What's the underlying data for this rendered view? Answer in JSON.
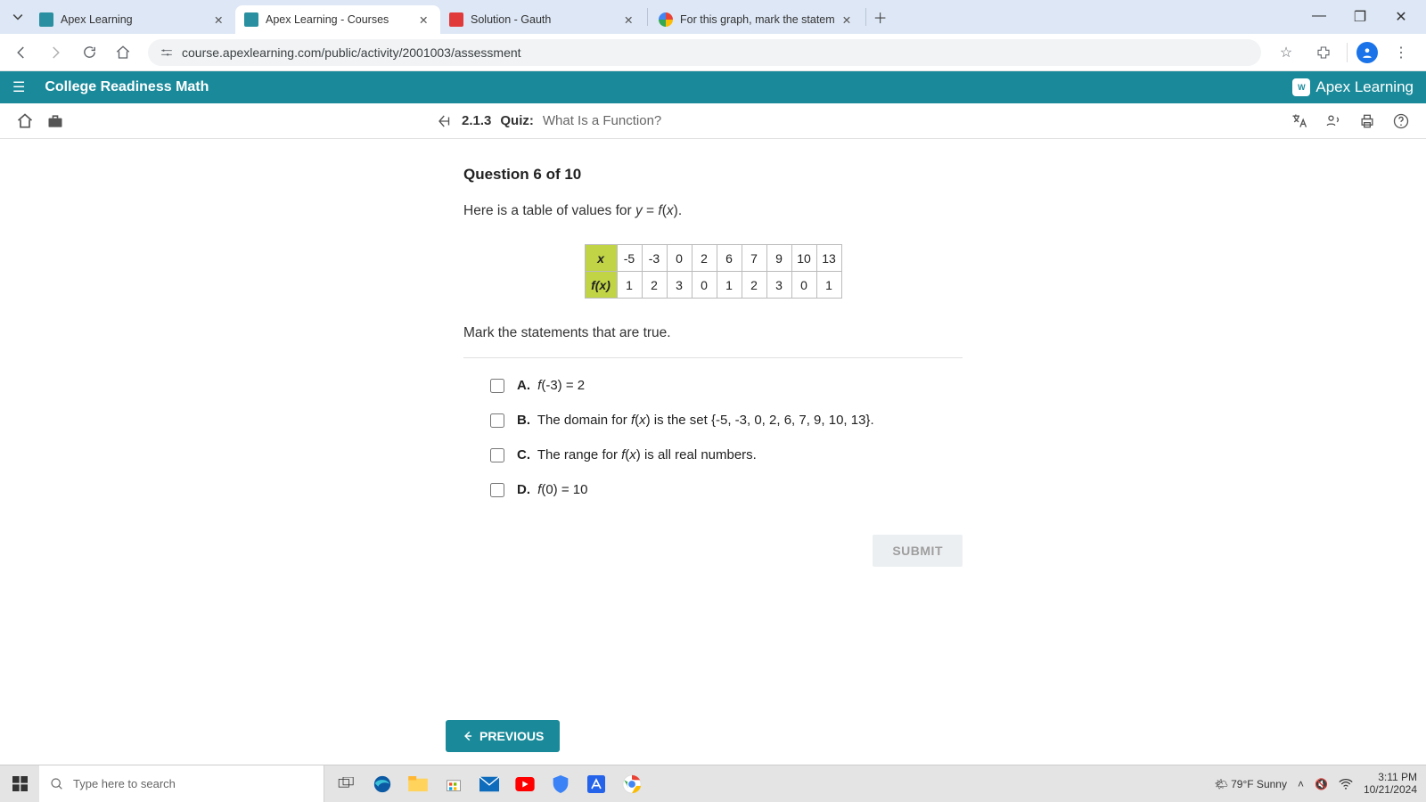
{
  "browser": {
    "tabs": [
      {
        "title": "Apex Learning"
      },
      {
        "title": "Apex Learning - Courses"
      },
      {
        "title": "Solution - Gauth"
      },
      {
        "title": "For this graph, mark the statem"
      }
    ],
    "url": "course.apexlearning.com/public/activity/2001003/assessment"
  },
  "apex": {
    "course_title": "College Readiness Math",
    "brand": "Apex Learning",
    "quiz_code": "2.1.3",
    "quiz_label": "Quiz:",
    "quiz_name": "What Is a Function?"
  },
  "question": {
    "header": "Question 6 of 10",
    "prompt_pre": "Here is a table of values for ",
    "prompt_eq": "y = f(x).",
    "instruction": "Mark the statements that are true.",
    "table": {
      "row1_label": "x",
      "row1": [
        "-5",
        "-3",
        "0",
        "2",
        "6",
        "7",
        "9",
        "10",
        "13"
      ],
      "row2_label": "f(x)",
      "row2": [
        "1",
        "2",
        "3",
        "0",
        "1",
        "2",
        "3",
        "0",
        "1"
      ]
    },
    "answers": [
      {
        "letter": "A.",
        "text": "f(-3) = 2"
      },
      {
        "letter": "B.",
        "text": "The domain for f(x) is the set {-5, -3, 0, 2, 6, 7, 9, 10, 13}."
      },
      {
        "letter": "C.",
        "text": "The range for f(x) is all real numbers."
      },
      {
        "letter": "D.",
        "text": "f(0) = 10"
      }
    ],
    "submit": "SUBMIT",
    "previous": "PREVIOUS"
  },
  "taskbar": {
    "search_placeholder": "Type here to search",
    "weather": "79°F  Sunny",
    "time": "3:11 PM",
    "date": "10/21/2024"
  }
}
